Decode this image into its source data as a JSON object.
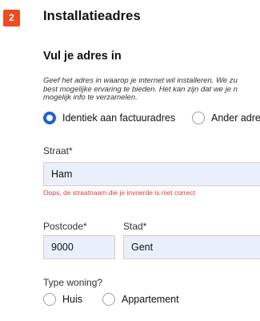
{
  "step": {
    "number": "2",
    "title": "Installatieadres"
  },
  "form": {
    "subtitle": "Vul je adres in",
    "intro_lines": [
      "Geef het adres in waarop je internet wil installeren. We zu",
      "best mogelijke ervaring te bieden. Het kan zijn dat we je n",
      "mogelijk info te verzamelen."
    ],
    "address_choice": {
      "options": [
        {
          "label": "Identiek aan factuuradres",
          "checked": true
        },
        {
          "label": "Ander adres",
          "checked": false
        }
      ]
    },
    "street": {
      "label": "Straat*",
      "value": "Ham",
      "error": "Oops, de straatnaam die je invoerde is niet correct"
    },
    "postcode": {
      "label": "Postcode*",
      "value": "9000"
    },
    "city": {
      "label": "Stad*",
      "value": "Gent"
    },
    "housing": {
      "label": "Type woning?",
      "options": [
        {
          "label": "Huis",
          "checked": false
        },
        {
          "label": "Appartement",
          "checked": false
        }
      ]
    }
  },
  "colors": {
    "accent": "#ef4b1f",
    "radio_selected": "#1c63d4",
    "error": "#e0393e",
    "field_bg": "#e9f0fb"
  }
}
